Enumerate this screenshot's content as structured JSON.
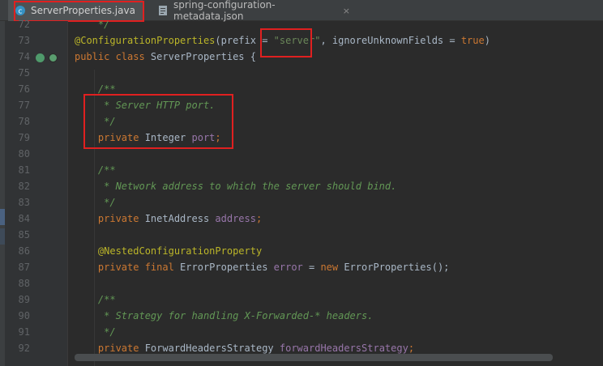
{
  "tabs": [
    {
      "label": "ServerProperties.java",
      "active": true,
      "icon": "java-class-icon"
    },
    {
      "label": "spring-configuration-metadata.json",
      "active": false,
      "icon": "json-file-icon",
      "close": "×"
    }
  ],
  "lines": [
    {
      "num": "72",
      "tokens": [
        {
          "t": "    */",
          "c": "cmt"
        }
      ]
    },
    {
      "num": "73",
      "tokens": [
        {
          "t": "@ConfigurationProperties",
          "c": "ann"
        },
        {
          "t": "(prefix = ",
          "c": "id"
        },
        {
          "t": "\"server\"",
          "c": "str"
        },
        {
          "t": ", ignoreUnknownFields = ",
          "c": "id"
        },
        {
          "t": "true",
          "c": "kw"
        },
        {
          "t": ")",
          "c": "id"
        }
      ]
    },
    {
      "num": "74",
      "tokens": [
        {
          "t": "public class ",
          "c": "kw"
        },
        {
          "t": "ServerProperties {",
          "c": "id"
        }
      ]
    },
    {
      "num": "75",
      "tokens": []
    },
    {
      "num": "76",
      "tokens": [
        {
          "t": "    /**",
          "c": "cmt"
        }
      ]
    },
    {
      "num": "77",
      "tokens": [
        {
          "t": "     * Server HTTP port.",
          "c": "cmt"
        }
      ]
    },
    {
      "num": "78",
      "tokens": [
        {
          "t": "     */",
          "c": "cmt"
        }
      ]
    },
    {
      "num": "79",
      "tokens": [
        {
          "t": "    private ",
          "c": "kw"
        },
        {
          "t": "Integer ",
          "c": "id"
        },
        {
          "t": "port",
          "c": "fld"
        },
        {
          "t": ";",
          "c": "kw"
        }
      ]
    },
    {
      "num": "80",
      "tokens": []
    },
    {
      "num": "81",
      "tokens": [
        {
          "t": "    /**",
          "c": "cmt"
        }
      ]
    },
    {
      "num": "82",
      "tokens": [
        {
          "t": "     * Network address to which the server should bind.",
          "c": "cmt"
        }
      ]
    },
    {
      "num": "83",
      "tokens": [
        {
          "t": "     */",
          "c": "cmt"
        }
      ]
    },
    {
      "num": "84",
      "tokens": [
        {
          "t": "    private ",
          "c": "kw"
        },
        {
          "t": "InetAddress ",
          "c": "id"
        },
        {
          "t": "address",
          "c": "fld"
        },
        {
          "t": ";",
          "c": "kw"
        }
      ]
    },
    {
      "num": "85",
      "tokens": []
    },
    {
      "num": "86",
      "tokens": [
        {
          "t": "    @NestedConfigurationProperty",
          "c": "ann"
        }
      ]
    },
    {
      "num": "87",
      "tokens": [
        {
          "t": "    private final ",
          "c": "kw"
        },
        {
          "t": "ErrorProperties ",
          "c": "id"
        },
        {
          "t": "error",
          "c": "fld"
        },
        {
          "t": " = ",
          "c": "id"
        },
        {
          "t": "new ",
          "c": "kw"
        },
        {
          "t": "ErrorProperties();",
          "c": "id"
        }
      ]
    },
    {
      "num": "88",
      "tokens": []
    },
    {
      "num": "89",
      "tokens": [
        {
          "t": "    /**",
          "c": "cmt"
        }
      ]
    },
    {
      "num": "90",
      "tokens": [
        {
          "t": "     * Strategy for handling X-Forwarded-* headers.",
          "c": "cmt"
        }
      ]
    },
    {
      "num": "91",
      "tokens": [
        {
          "t": "     */",
          "c": "cmt"
        }
      ]
    },
    {
      "num": "92",
      "tokens": [
        {
          "t": "    private ",
          "c": "kw"
        },
        {
          "t": "ForwardHeadersStrategy ",
          "c": "id"
        },
        {
          "t": "forwardHeadersStrategy",
          "c": "fld"
        },
        {
          "t": ";",
          "c": "kw"
        }
      ]
    }
  ],
  "colors": {
    "annotation": "#bbb529",
    "keyword": "#cc7832",
    "string": "#6a8759",
    "comment": "#629755",
    "field": "#9876aa",
    "highlight_box": "#e02020"
  }
}
